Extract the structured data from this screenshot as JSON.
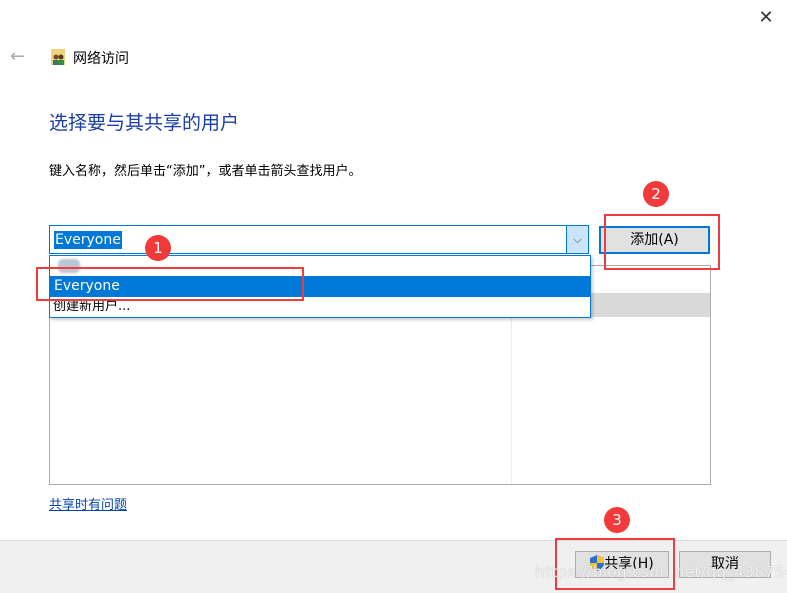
{
  "window": {
    "title": "网络访问",
    "close_icon": "close-icon",
    "back_icon": "back-arrow-icon"
  },
  "heading": "选择要与其共享的用户",
  "instruction": "键入名称，然后单击“添加”，或者单击箭头查找用户。",
  "combo": {
    "value": "Everyone",
    "options": [
      "Everyone",
      "创建新用户..."
    ]
  },
  "add_button": "添加(A)",
  "help_link": "共享时有问题",
  "footer": {
    "share_button": "共享(H)",
    "cancel_button": "取消"
  },
  "annotations": [
    "1",
    "2",
    "3"
  ],
  "watermark": "https://blog.csdn.net/qq_43875449",
  "colors": {
    "accent": "#0078d7",
    "heading": "#1a3ea8",
    "annotation": "#f23a3a"
  }
}
